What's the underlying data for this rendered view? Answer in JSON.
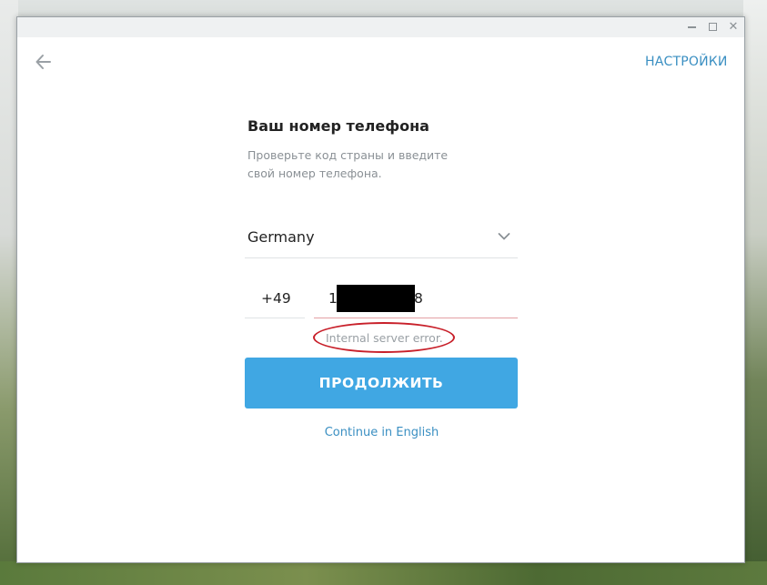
{
  "window": {
    "controls": {
      "minimize": "minimize",
      "maximize": "maximize",
      "close": "✕"
    }
  },
  "header": {
    "back_icon": "arrow-left-icon",
    "settings_label": "НАСТРОЙКИ"
  },
  "form": {
    "title": "Ваш номер телефона",
    "subtitle": "Проверьте код страны и введите свой номер телефона.",
    "country": {
      "value": "Germany",
      "icon": "chevron-down-icon"
    },
    "country_code": "+49",
    "phone": {
      "visible_start": "1",
      "visible_end": "8",
      "redacted": true
    },
    "error": "Internal server error.",
    "submit_label": "ПРОДОЛЖИТЬ",
    "language_link": "Continue in English"
  },
  "colors": {
    "accent": "#40a7e3",
    "link": "#3a8fc2",
    "error_annotation": "#c8202a",
    "error_underline": "#e3a0a4"
  }
}
